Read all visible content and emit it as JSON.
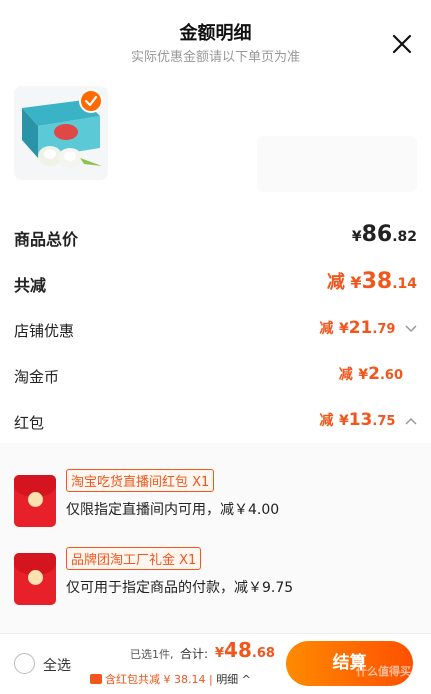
{
  "header": {
    "title": "金额明细",
    "subtitle": "实际优惠金额请以下单页为准"
  },
  "summary": {
    "total_label": "商品总价",
    "total_yen": "¥",
    "total_int": "86",
    "total_dec": ".82",
    "discount_label": "共减",
    "discount_prefix": "减",
    "discount_yen": "¥",
    "discount_int": "38",
    "discount_dec": ".14"
  },
  "items": [
    {
      "label": "店铺优惠",
      "prefix": "减",
      "yen": "¥",
      "int": "21",
      "dec": ".79",
      "chevron": "down"
    },
    {
      "label": "淘金币",
      "prefix": "减",
      "yen": "¥",
      "int": "2",
      "dec": ".60",
      "chevron": "none"
    },
    {
      "label": "红包",
      "prefix": "减",
      "yen": "¥",
      "int": "13",
      "dec": ".75",
      "chevron": "up"
    }
  ],
  "red_packets": [
    {
      "tag": "淘宝吃货直播间红包 X1",
      "desc": "仅限指定直播间内可用，减￥4.00"
    },
    {
      "tag": "品牌团淘工厂礼金 X1",
      "desc": "仅可用于指定商品的付款，减￥9.75"
    }
  ],
  "footer": {
    "select_all": "全选",
    "selected_count": "已选1件,",
    "sum_label": "合计:",
    "sum_yen": "¥",
    "sum_int": "48",
    "sum_dec": ".68",
    "sub_line": "含红包共减 ¥ 38.14 | ",
    "detail": "明细 ^",
    "pay_button": "结算",
    "watermark": "什么值得买"
  },
  "colors": {
    "accent": "#f2561d",
    "pay_gradient_start": "#ff8a00",
    "pay_gradient_end": "#ff5000",
    "red_packet": "#e8202a"
  }
}
